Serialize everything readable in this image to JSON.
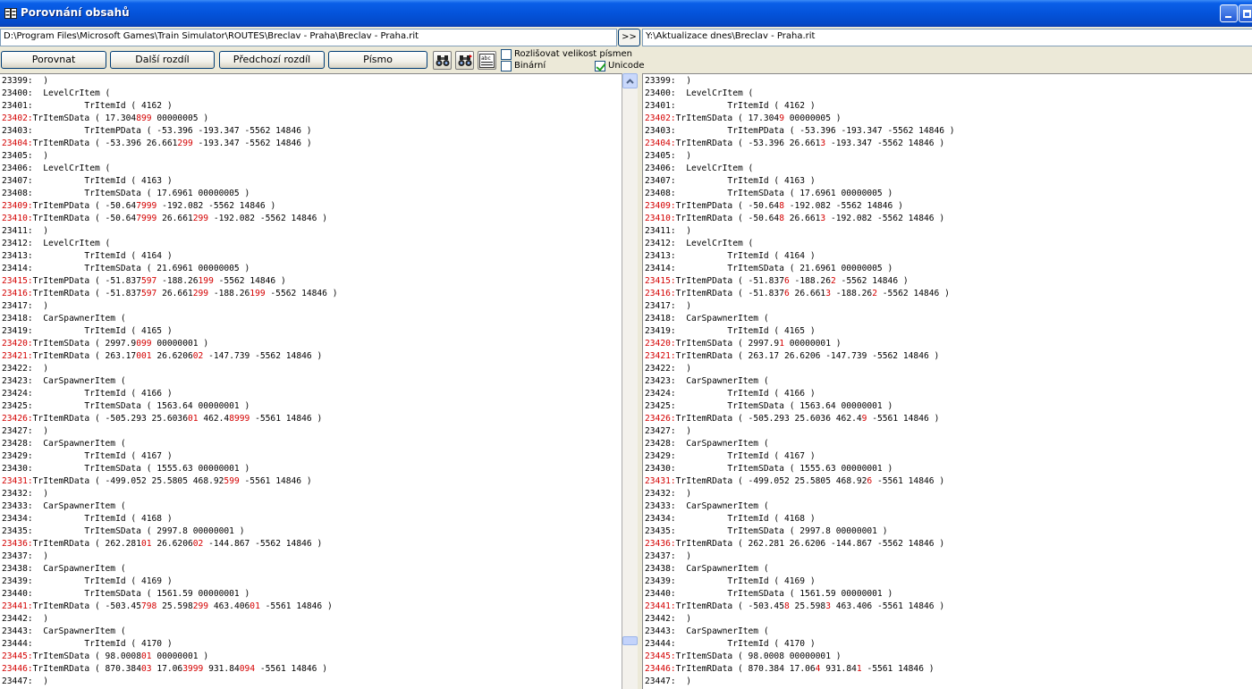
{
  "window": {
    "title": "Porovnání obsahů"
  },
  "paths": {
    "left": "D:\\Program Files\\Microsoft Games\\Train Simulator\\ROUTES\\Breclav - Praha\\Breclav - Praha.rit",
    "right": "Y:\\Aktualizace dnes\\Breclav - Praha.rit",
    "copy_label": ">>"
  },
  "toolbar": {
    "compare_label": "Porovnat",
    "next_label": "Další rozdíl",
    "prev_label": "Předchozí rozdíl",
    "font_label": "Písmo",
    "icon3_text": "abc"
  },
  "options": {
    "case_label": "Rozlišovat velikost písmen",
    "case_checked": false,
    "binary_label": "Binární",
    "binary_checked": false,
    "unicode_label": "Unicode",
    "unicode_checked": true
  },
  "colors": {
    "diff": "#d40000",
    "titlebar": "#0453da"
  },
  "left_lines": [
    {
      "n": "23399:",
      "t": "\t)",
      "d": false
    },
    {
      "n": "23400:",
      "t": "\tLevelCrItem (",
      "d": false
    },
    {
      "n": "23401:",
      "t": "\t\tTrItemId ( 4162 )",
      "d": false
    },
    {
      "n": "23402:",
      "t": "TrItemSData ( 17.304899 00000005 )",
      "d": true
    },
    {
      "n": "23403:",
      "t": "\t\tTrItemPData ( -53.396 -193.347 -5562 14846 )",
      "d": false
    },
    {
      "n": "23404:",
      "t": "TrItemRData ( -53.396 26.661299 -193.347 -5562 14846 )",
      "d": true
    },
    {
      "n": "23405:",
      "t": "\t)",
      "d": false
    },
    {
      "n": "23406:",
      "t": "\tLevelCrItem (",
      "d": false
    },
    {
      "n": "23407:",
      "t": "\t\tTrItemId ( 4163 )",
      "d": false
    },
    {
      "n": "23408:",
      "t": "\t\tTrItemSData ( 17.6961 00000005 )",
      "d": false
    },
    {
      "n": "23409:",
      "t": "TrItemPData ( -50.647999 -192.082 -5562 14846 )",
      "d": true
    },
    {
      "n": "23410:",
      "t": "TrItemRData ( -50.647999 26.661299 -192.082 -5562 14846 )",
      "d": true
    },
    {
      "n": "23411:",
      "t": "\t)",
      "d": false
    },
    {
      "n": "23412:",
      "t": "\tLevelCrItem (",
      "d": false
    },
    {
      "n": "23413:",
      "t": "\t\tTrItemId ( 4164 )",
      "d": false
    },
    {
      "n": "23414:",
      "t": "\t\tTrItemSData ( 21.6961 00000005 )",
      "d": false
    },
    {
      "n": "23415:",
      "t": "TrItemPData ( -51.837597 -188.26199 -5562 14846 )",
      "d": true
    },
    {
      "n": "23416:",
      "t": "TrItemRData ( -51.837597 26.661299 -188.26199 -5562 14846 )",
      "d": true
    },
    {
      "n": "23417:",
      "t": "\t)",
      "d": false
    },
    {
      "n": "23418:",
      "t": "\tCarSpawnerItem (",
      "d": false
    },
    {
      "n": "23419:",
      "t": "\t\tTrItemId ( 4165 )",
      "d": false
    },
    {
      "n": "23420:",
      "t": "TrItemSData ( 2997.9099 00000001 )",
      "d": true
    },
    {
      "n": "23421:",
      "t": "TrItemRData ( 263.17001 26.620602 -147.739 -5562 14846 )",
      "d": true
    },
    {
      "n": "23422:",
      "t": "\t)",
      "d": false
    },
    {
      "n": "23423:",
      "t": "\tCarSpawnerItem (",
      "d": false
    },
    {
      "n": "23424:",
      "t": "\t\tTrItemId ( 4166 )",
      "d": false
    },
    {
      "n": "23425:",
      "t": "\t\tTrItemSData ( 1563.64 00000001 )",
      "d": false
    },
    {
      "n": "23426:",
      "t": "TrItemRData ( -505.293 25.603601 462.48999 -5561 14846 )",
      "d": true
    },
    {
      "n": "23427:",
      "t": "\t)",
      "d": false
    },
    {
      "n": "23428:",
      "t": "\tCarSpawnerItem (",
      "d": false
    },
    {
      "n": "23429:",
      "t": "\t\tTrItemId ( 4167 )",
      "d": false
    },
    {
      "n": "23430:",
      "t": "\t\tTrItemSData ( 1555.63 00000001 )",
      "d": false
    },
    {
      "n": "23431:",
      "t": "TrItemRData ( -499.052 25.5805 468.92599 -5561 14846 )",
      "d": true
    },
    {
      "n": "23432:",
      "t": "\t)",
      "d": false
    },
    {
      "n": "23433:",
      "t": "\tCarSpawnerItem (",
      "d": false
    },
    {
      "n": "23434:",
      "t": "\t\tTrItemId ( 4168 )",
      "d": false
    },
    {
      "n": "23435:",
      "t": "\t\tTrItemSData ( 2997.8 00000001 )",
      "d": false
    },
    {
      "n": "23436:",
      "t": "TrItemRData ( 262.28101 26.620602 -144.867 -5562 14846 )",
      "d": true
    },
    {
      "n": "23437:",
      "t": "\t)",
      "d": false
    },
    {
      "n": "23438:",
      "t": "\tCarSpawnerItem (",
      "d": false
    },
    {
      "n": "23439:",
      "t": "\t\tTrItemId ( 4169 )",
      "d": false
    },
    {
      "n": "23440:",
      "t": "\t\tTrItemSData ( 1561.59 00000001 )",
      "d": false
    },
    {
      "n": "23441:",
      "t": "TrItemRData ( -503.45798 25.598299 463.40601 -5561 14846 )",
      "d": true
    },
    {
      "n": "23442:",
      "t": "\t)",
      "d": false
    },
    {
      "n": "23443:",
      "t": "\tCarSpawnerItem (",
      "d": false
    },
    {
      "n": "23444:",
      "t": "\t\tTrItemId ( 4170 )",
      "d": false
    },
    {
      "n": "23445:",
      "t": "TrItemSData ( 98.000801 00000001 )",
      "d": true
    },
    {
      "n": "23446:",
      "t": "TrItemRData ( 870.38403 17.063999 931.84094 -5561 14846 )",
      "d": true
    },
    {
      "n": "23447:",
      "t": "\t)",
      "d": false
    }
  ],
  "right_lines": [
    {
      "n": "23399:",
      "t": "\t)",
      "d": false
    },
    {
      "n": "23400:",
      "t": "\tLevelCrItem (",
      "d": false
    },
    {
      "n": "23401:",
      "t": "\t\tTrItemId ( 4162 )",
      "d": false
    },
    {
      "n": "23402:",
      "t": "TrItemSData ( 17.3049 00000005 )",
      "d": true
    },
    {
      "n": "23403:",
      "t": "\t\tTrItemPData ( -53.396 -193.347 -5562 14846 )",
      "d": false
    },
    {
      "n": "23404:",
      "t": "TrItemRData ( -53.396 26.6613 -193.347 -5562 14846 )",
      "d": true
    },
    {
      "n": "23405:",
      "t": "\t)",
      "d": false
    },
    {
      "n": "23406:",
      "t": "\tLevelCrItem (",
      "d": false
    },
    {
      "n": "23407:",
      "t": "\t\tTrItemId ( 4163 )",
      "d": false
    },
    {
      "n": "23408:",
      "t": "\t\tTrItemSData ( 17.6961 00000005 )",
      "d": false
    },
    {
      "n": "23409:",
      "t": "TrItemPData ( -50.648 -192.082 -5562 14846 )",
      "d": true
    },
    {
      "n": "23410:",
      "t": "TrItemRData ( -50.648 26.6613 -192.082 -5562 14846 )",
      "d": true
    },
    {
      "n": "23411:",
      "t": "\t)",
      "d": false
    },
    {
      "n": "23412:",
      "t": "\tLevelCrItem (",
      "d": false
    },
    {
      "n": "23413:",
      "t": "\t\tTrItemId ( 4164 )",
      "d": false
    },
    {
      "n": "23414:",
      "t": "\t\tTrItemSData ( 21.6961 00000005 )",
      "d": false
    },
    {
      "n": "23415:",
      "t": "TrItemPData ( -51.8376 -188.262 -5562 14846 )",
      "d": true
    },
    {
      "n": "23416:",
      "t": "TrItemRData ( -51.8376 26.6613 -188.262 -5562 14846 )",
      "d": true
    },
    {
      "n": "23417:",
      "t": "\t)",
      "d": false
    },
    {
      "n": "23418:",
      "t": "\tCarSpawnerItem (",
      "d": false
    },
    {
      "n": "23419:",
      "t": "\t\tTrItemId ( 4165 )",
      "d": false
    },
    {
      "n": "23420:",
      "t": "TrItemSData ( 2997.91 00000001 )",
      "d": true
    },
    {
      "n": "23421:",
      "t": "TrItemRData ( 263.17 26.6206 -147.739 -5562 14846 )",
      "d": true
    },
    {
      "n": "23422:",
      "t": "\t)",
      "d": false
    },
    {
      "n": "23423:",
      "t": "\tCarSpawnerItem (",
      "d": false
    },
    {
      "n": "23424:",
      "t": "\t\tTrItemId ( 4166 )",
      "d": false
    },
    {
      "n": "23425:",
      "t": "\t\tTrItemSData ( 1563.64 00000001 )",
      "d": false
    },
    {
      "n": "23426:",
      "t": "TrItemRData ( -505.293 25.6036 462.49 -5561 14846 )",
      "d": true
    },
    {
      "n": "23427:",
      "t": "\t)",
      "d": false
    },
    {
      "n": "23428:",
      "t": "\tCarSpawnerItem (",
      "d": false
    },
    {
      "n": "23429:",
      "t": "\t\tTrItemId ( 4167 )",
      "d": false
    },
    {
      "n": "23430:",
      "t": "\t\tTrItemSData ( 1555.63 00000001 )",
      "d": false
    },
    {
      "n": "23431:",
      "t": "TrItemRData ( -499.052 25.5805 468.926 -5561 14846 )",
      "d": true
    },
    {
      "n": "23432:",
      "t": "\t)",
      "d": false
    },
    {
      "n": "23433:",
      "t": "\tCarSpawnerItem (",
      "d": false
    },
    {
      "n": "23434:",
      "t": "\t\tTrItemId ( 4168 )",
      "d": false
    },
    {
      "n": "23435:",
      "t": "\t\tTrItemSData ( 2997.8 00000001 )",
      "d": false
    },
    {
      "n": "23436:",
      "t": "TrItemRData ( 262.281 26.6206 -144.867 -5562 14846 )",
      "d": true
    },
    {
      "n": "23437:",
      "t": "\t)",
      "d": false
    },
    {
      "n": "23438:",
      "t": "\tCarSpawnerItem (",
      "d": false
    },
    {
      "n": "23439:",
      "t": "\t\tTrItemId ( 4169 )",
      "d": false
    },
    {
      "n": "23440:",
      "t": "\t\tTrItemSData ( 1561.59 00000001 )",
      "d": false
    },
    {
      "n": "23441:",
      "t": "TrItemRData ( -503.458 25.5983 463.406 -5561 14846 )",
      "d": true
    },
    {
      "n": "23442:",
      "t": "\t)",
      "d": false
    },
    {
      "n": "23443:",
      "t": "\tCarSpawnerItem (",
      "d": false
    },
    {
      "n": "23444:",
      "t": "\t\tTrItemId ( 4170 )",
      "d": false
    },
    {
      "n": "23445:",
      "t": "TrItemSData ( 98.0008 00000001 )",
      "d": true
    },
    {
      "n": "23446:",
      "t": "TrItemRData ( 870.384 17.064 931.841 -5561 14846 )",
      "d": true
    },
    {
      "n": "23447:",
      "t": "\t)",
      "d": false
    }
  ]
}
